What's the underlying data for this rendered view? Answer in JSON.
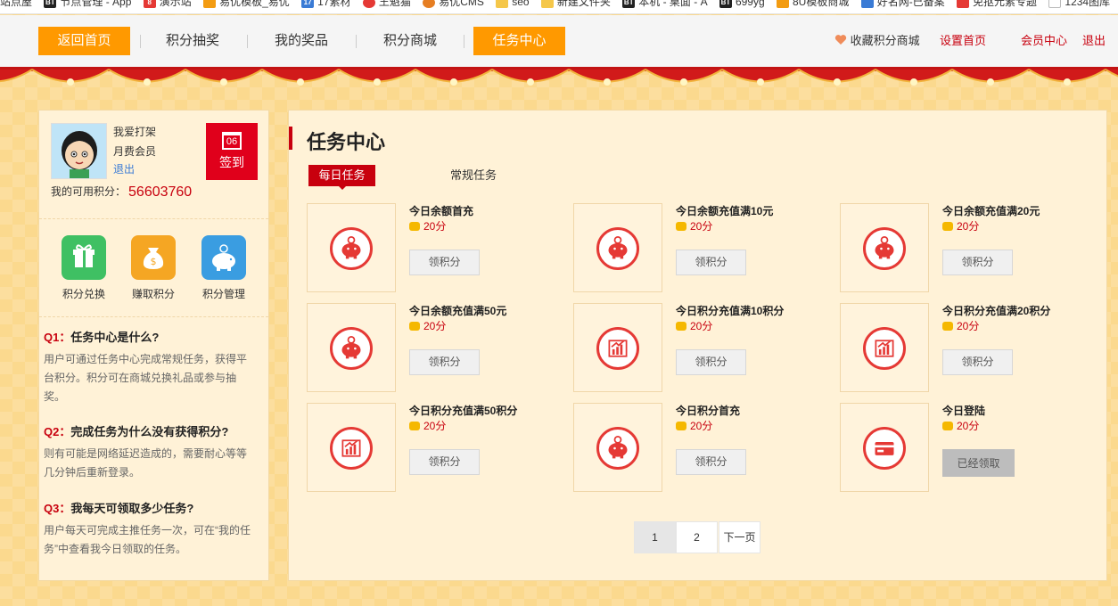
{
  "bookmarks": [
    {
      "label": "站点屋",
      "icon": "",
      "color": ""
    },
    {
      "label": "节点管理 - App",
      "icon": "BT",
      "color": "#222222"
    },
    {
      "label": "演示站",
      "icon": "8",
      "color": "#e53935"
    },
    {
      "label": "易优模板_易优",
      "icon": "",
      "color": "#f39c12"
    },
    {
      "label": "17素材",
      "icon": "17",
      "color": "#3a7bd5"
    },
    {
      "label": "王魁猫",
      "icon": "",
      "color": "#e53935"
    },
    {
      "label": "易优CMS",
      "icon": "",
      "color": "#e67e22"
    },
    {
      "label": "seo",
      "icon": "",
      "color": "#f5c74a"
    },
    {
      "label": "新建文件夹",
      "icon": "",
      "color": "#f5c74a"
    },
    {
      "label": "本机 - 桌面 - A",
      "icon": "BT",
      "color": "#222222"
    },
    {
      "label": "699yg",
      "icon": "BT",
      "color": "#222222"
    },
    {
      "label": "8U模板商城",
      "icon": "",
      "color": "#f39c12"
    },
    {
      "label": "好名网-已备案",
      "icon": "",
      "color": "#3a7bd5"
    },
    {
      "label": "免抠元素专题",
      "icon": "",
      "color": "#e53935"
    },
    {
      "label": "1234图库",
      "icon": "",
      "color": "#cccccc"
    }
  ],
  "nav": {
    "items": [
      "返回首页",
      "积分抽奖",
      "我的奖品",
      "积分商城",
      "任务中心"
    ],
    "fav": "收藏积分商城",
    "set_home": "设置首页",
    "member": "会员中心",
    "logout": "退出"
  },
  "user": {
    "name": "我爱打架",
    "level": "月费会员",
    "logout": "退出",
    "sign_date": "06",
    "sign_label": "签到",
    "points_label": "我的可用积分：",
    "points": "56603760"
  },
  "quick": [
    "积分兑换",
    "赚取积分",
    "积分管理"
  ],
  "faq": [
    {
      "no": "Q1：",
      "q": "任务中心是什么?",
      "a": "用户可通过任务中心完成常规任务，获得平台积分。积分可在商城兑换礼品或参与抽奖。"
    },
    {
      "no": "Q2：",
      "q": "完成任务为什么没有获得积分?",
      "a": "则有可能是网络延迟造成的，需要耐心等等几分钟后重新登录。"
    },
    {
      "no": "Q3：",
      "q": "我每天可领取多少任务?",
      "a": "用户每天可完成主推任务一次，可在“我的任务”中查看我今日领取的任务。"
    }
  ],
  "main": {
    "title": "任务中心",
    "tab_daily": "每日任务",
    "tab_regular": "常规任务"
  },
  "tasks": [
    {
      "title": "今日余额首充",
      "points": "20分",
      "button": "领积分",
      "icon": "piggy-icon",
      "done": false
    },
    {
      "title": "今日余额充值满10元",
      "points": "20分",
      "button": "领积分",
      "icon": "piggy-icon",
      "done": false
    },
    {
      "title": "今日余额充值满20元",
      "points": "20分",
      "button": "领积分",
      "icon": "piggy-icon",
      "done": false
    },
    {
      "title": "今日余额充值满50元",
      "points": "20分",
      "button": "领积分",
      "icon": "piggy-icon",
      "done": false
    },
    {
      "title": "今日积分充值满10积分",
      "points": "20分",
      "button": "领积分",
      "icon": "chart-icon",
      "done": false
    },
    {
      "title": "今日积分充值满20积分",
      "points": "20分",
      "button": "领积分",
      "icon": "chart-icon",
      "done": false
    },
    {
      "title": "今日积分充值满50积分",
      "points": "20分",
      "button": "领积分",
      "icon": "chart-icon",
      "done": false
    },
    {
      "title": "今日积分首充",
      "points": "20分",
      "button": "领积分",
      "icon": "piggy-icon",
      "done": false
    },
    {
      "title": "今日登陆",
      "points": "20分",
      "button": "已经领取",
      "icon": "card-icon",
      "done": true
    }
  ],
  "pagination": {
    "p1": "1",
    "p2": "2",
    "next": "下一页"
  },
  "colors": {
    "accent": "#ff9900",
    "red": "#c8000e",
    "panel": "#fff2d7"
  }
}
